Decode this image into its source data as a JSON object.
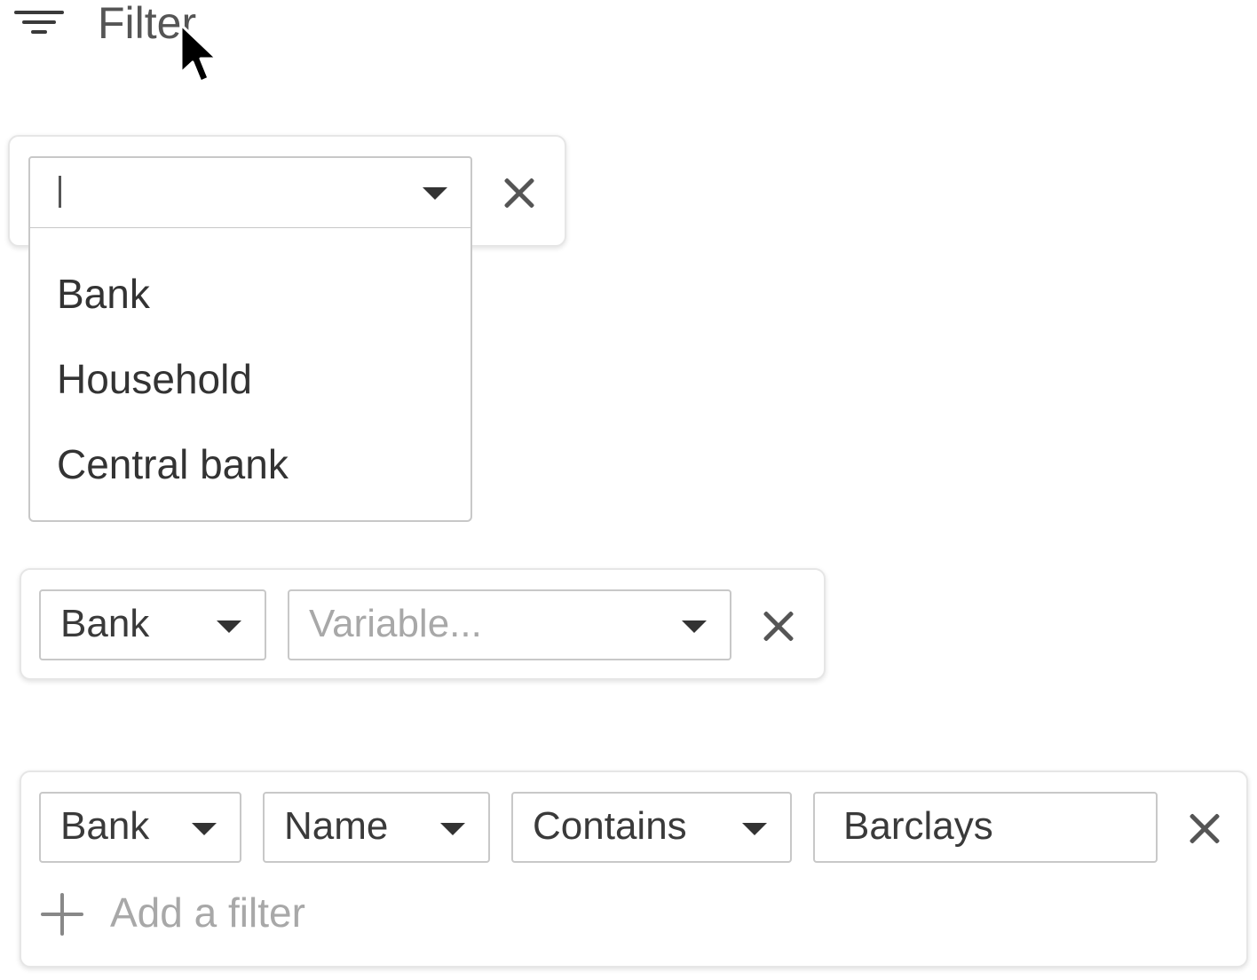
{
  "header": {
    "title": "Filter",
    "icon": "filter-icon"
  },
  "filter_row_1": {
    "input_value": "",
    "dropdown_options": [
      "Bank",
      "Household",
      "Central bank"
    ]
  },
  "filter_row_2": {
    "entity_value": "Bank",
    "variable_placeholder": "Variable..."
  },
  "filter_row_3": {
    "entity_value": "Bank",
    "field_value": "Name",
    "operator_value": "Contains",
    "text_value": "Barclays",
    "add_filter_label": "Add a filter"
  }
}
